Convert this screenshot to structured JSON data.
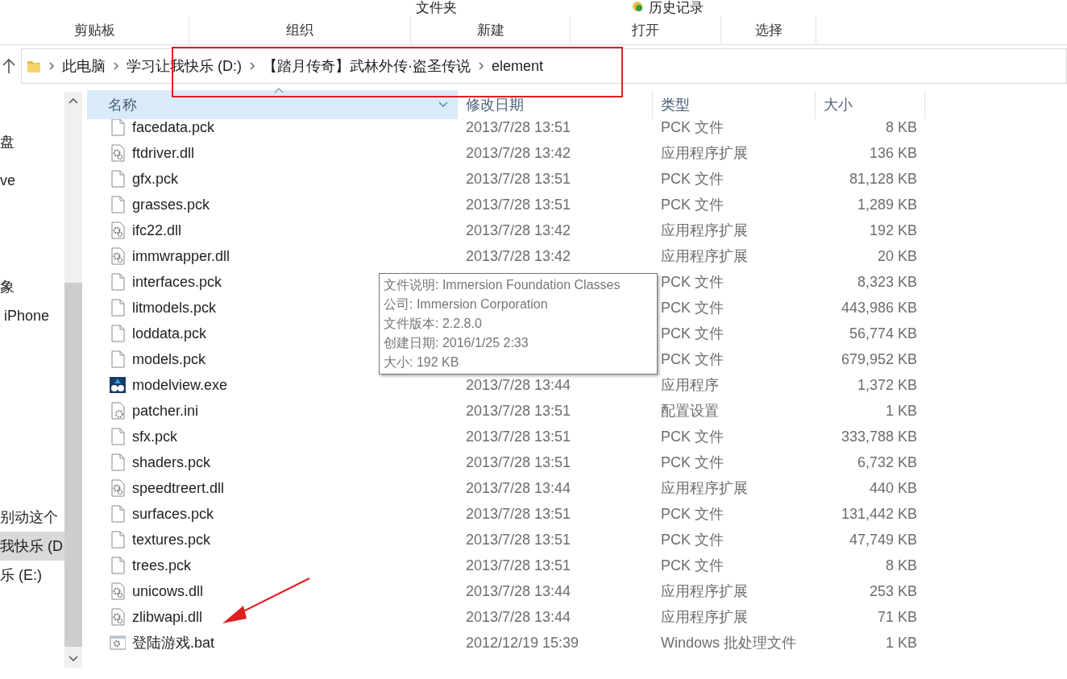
{
  "ribbon": {
    "top_items": [
      {
        "label": "文件夹",
        "kind": "plain"
      },
      {
        "label": "历史记录",
        "kind": "history"
      }
    ],
    "groups": [
      "剪贴板",
      "组织",
      "新建",
      "打开",
      "选择"
    ]
  },
  "address_bar": {
    "crumbs": [
      "此电脑",
      "学习让我快乐 (D:)",
      "【踏月传奇】武林外传·盗圣传说",
      "element"
    ]
  },
  "nav_pane": {
    "items": [
      {
        "label": "盘",
        "selected": false
      },
      {
        "label": "ve",
        "selected": false
      },
      {
        "label": "象",
        "selected": false
      },
      {
        "label": " iPhone",
        "selected": false
      },
      {
        "label": "别动这个",
        "selected": false
      },
      {
        "label": "我快乐 (D",
        "selected": true
      },
      {
        "label": "乐 (E:)",
        "selected": false
      }
    ]
  },
  "table": {
    "columns": [
      {
        "label": "名称",
        "sorted": true
      },
      {
        "label": "修改日期",
        "sorted": false
      },
      {
        "label": "类型",
        "sorted": false
      },
      {
        "label": "大小",
        "sorted": false
      }
    ],
    "rows": [
      {
        "name": "facedata.pck",
        "kind": "plain",
        "date": "2013/7/28 13:51",
        "type": "PCK 文件",
        "size": "8 KB"
      },
      {
        "name": "ftdriver.dll",
        "kind": "gear",
        "date": "2013/7/28 13:42",
        "type": "应用程序扩展",
        "size": "136 KB"
      },
      {
        "name": "gfx.pck",
        "kind": "plain",
        "date": "2013/7/28 13:51",
        "type": "PCK 文件",
        "size": "81,128 KB"
      },
      {
        "name": "grasses.pck",
        "kind": "plain",
        "date": "2013/7/28 13:51",
        "type": "PCK 文件",
        "size": "1,289 KB"
      },
      {
        "name": "ifc22.dll",
        "kind": "gear",
        "date": "2013/7/28 13:42",
        "type": "应用程序扩展",
        "size": "192 KB"
      },
      {
        "name": "immwrapper.dll",
        "kind": "gear",
        "date": "2013/7/28 13:42",
        "type": "应用程序扩展",
        "size": "20 KB"
      },
      {
        "name": "interfaces.pck",
        "kind": "plain",
        "type": "PCK 文件",
        "size": "8,323 KB"
      },
      {
        "name": "litmodels.pck",
        "kind": "plain",
        "type": "PCK 文件",
        "size": "443,986 KB"
      },
      {
        "name": "loddata.pck",
        "kind": "plain",
        "type": "PCK 文件",
        "size": "56,774 KB"
      },
      {
        "name": "models.pck",
        "kind": "plain",
        "type": "PCK 文件",
        "size": "679,952 KB"
      },
      {
        "name": "modelview.exe",
        "kind": "app",
        "date": "2013/7/28 13:44",
        "type": "应用程序",
        "size": "1,372 KB"
      },
      {
        "name": "patcher.ini",
        "kind": "settings",
        "date": "2013/7/28 13:51",
        "type": "配置设置",
        "size": "1 KB"
      },
      {
        "name": "sfx.pck",
        "kind": "plain",
        "date": "2013/7/28 13:51",
        "type": "PCK 文件",
        "size": "333,788 KB"
      },
      {
        "name": "shaders.pck",
        "kind": "plain",
        "date": "2013/7/28 13:51",
        "type": "PCK 文件",
        "size": "6,732 KB"
      },
      {
        "name": "speedtreert.dll",
        "kind": "gear",
        "date": "2013/7/28 13:44",
        "type": "应用程序扩展",
        "size": "440 KB"
      },
      {
        "name": "surfaces.pck",
        "kind": "plain",
        "date": "2013/7/28 13:51",
        "type": "PCK 文件",
        "size": "131,442 KB"
      },
      {
        "name": "textures.pck",
        "kind": "plain",
        "date": "2013/7/28 13:51",
        "type": "PCK 文件",
        "size": "47,749 KB"
      },
      {
        "name": "trees.pck",
        "kind": "plain",
        "date": "2013/7/28 13:51",
        "type": "PCK 文件",
        "size": "8 KB"
      },
      {
        "name": "unicows.dll",
        "kind": "gear",
        "date": "2013/7/28 13:44",
        "type": "应用程序扩展",
        "size": "253 KB"
      },
      {
        "name": "zlibwapi.dll",
        "kind": "gear",
        "date": "2013/7/28 13:44",
        "type": "应用程序扩展",
        "size": "71 KB"
      },
      {
        "name": "登陆游戏.bat",
        "kind": "script",
        "date": "2012/12/19 15:39",
        "type": "Windows 批处理文件",
        "size": "1 KB"
      }
    ]
  },
  "tooltip": {
    "lines": [
      "文件说明: Immersion Foundation Classes",
      "公司: Immersion Corporation",
      "文件版本: 2.2.8.0",
      "创建日期: 2016/1/25 2:33",
      "大小: 192 KB"
    ]
  }
}
